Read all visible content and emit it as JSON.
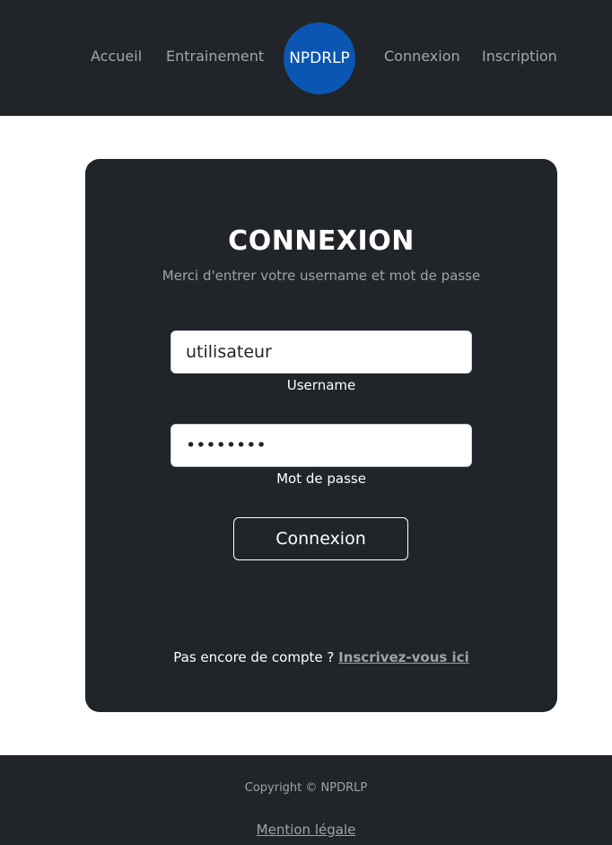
{
  "nav": {
    "links": [
      "Accueil",
      "Entrainement",
      "Connexion",
      "Inscription"
    ],
    "logo_text": "NPDRLP",
    "logo_color": "#0b56b3"
  },
  "login": {
    "title": "CONNEXION",
    "subtitle": "Merci d'entrer votre username et mot de passe",
    "username_value": "utilisateur",
    "username_label": "Username",
    "password_value": "********",
    "password_label": "Mot de passe",
    "submit_label": "Connexion",
    "signup_prompt": "Pas encore de compte ?",
    "signup_link": "Inscrivez-vous ici"
  },
  "footer": {
    "copyright": "Copyright © NPDRLP",
    "legal_link": "Mention légale"
  },
  "colors": {
    "dark_background": "#212529",
    "muted_text": "#9ea3a8",
    "accent": "#0b56b3"
  }
}
